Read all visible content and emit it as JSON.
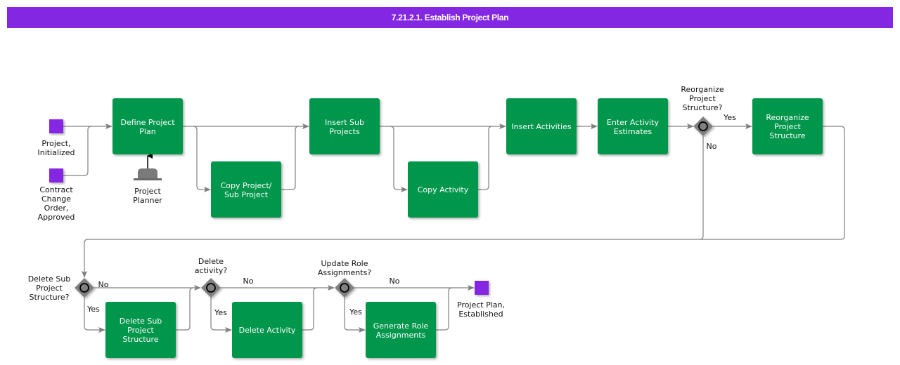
{
  "title": "7.21.2.1. Establish Project Plan",
  "colors": {
    "title_bg": "#8427e2",
    "task": "#00964b",
    "event": "#8427e2",
    "gateway": "#808080",
    "flow": "#808080"
  },
  "events": [
    {
      "id": "ev-project-initialized",
      "lines": [
        "Project,",
        "Initialized"
      ]
    },
    {
      "id": "ev-contract-change",
      "lines": [
        "Contract",
        "Change",
        "Order,",
        "Approved"
      ]
    },
    {
      "id": "ev-plan-established",
      "lines": [
        "Project Plan,",
        "Established"
      ]
    }
  ],
  "role": {
    "lines": [
      "Project",
      "Planner"
    ],
    "icon": "hat-icon"
  },
  "tasks": [
    {
      "id": "define-project-plan",
      "lines": [
        "Define Project",
        "Plan"
      ]
    },
    {
      "id": "copy-project",
      "lines": [
        "Copy Project/",
        "Sub Project"
      ]
    },
    {
      "id": "insert-sub-projects",
      "lines": [
        "Insert Sub",
        "Projects"
      ]
    },
    {
      "id": "copy-activity",
      "lines": [
        "Copy Activity"
      ]
    },
    {
      "id": "insert-activities",
      "lines": [
        "Insert Activities"
      ]
    },
    {
      "id": "enter-activity-estimates",
      "lines": [
        "Enter Activity",
        "Estimates"
      ]
    },
    {
      "id": "reorganize-project-structure",
      "lines": [
        "Reorganize",
        "Project",
        "Structure"
      ]
    },
    {
      "id": "delete-sub-project-structure",
      "lines": [
        "Delete Sub",
        "Project",
        "Structure"
      ]
    },
    {
      "id": "delete-activity",
      "lines": [
        "Delete Activity"
      ]
    },
    {
      "id": "generate-role-assignments",
      "lines": [
        "Generate Role",
        "Assignments"
      ]
    }
  ],
  "gateways": [
    {
      "id": "gw-reorganize",
      "lines": [
        "Reorganize",
        "Project",
        "Structure?"
      ],
      "yes": "Yes",
      "no": "No"
    },
    {
      "id": "gw-delete-sub",
      "lines": [
        "Delete Sub",
        "Project",
        "Structure?"
      ],
      "yes": "Yes",
      "no": "No"
    },
    {
      "id": "gw-delete-activity",
      "lines": [
        "Delete",
        "activity?"
      ],
      "yes": "Yes",
      "no": "No"
    },
    {
      "id": "gw-update-roles",
      "lines": [
        "Update Role",
        "Assignments?"
      ],
      "yes": "Yes",
      "no": "No"
    }
  ]
}
